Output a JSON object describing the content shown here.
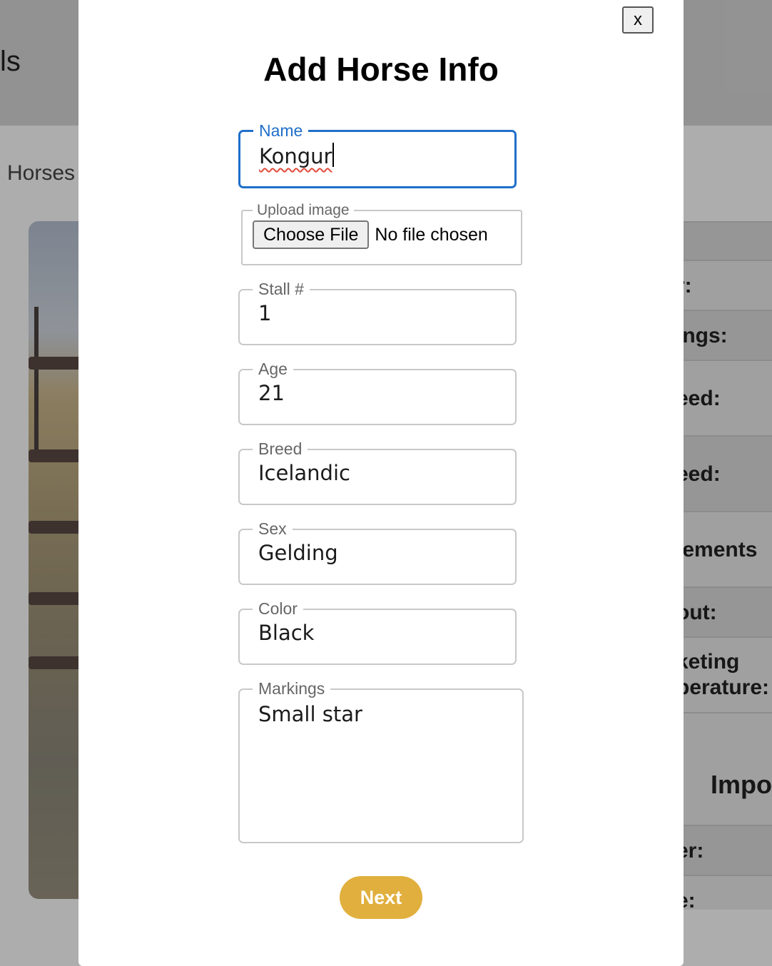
{
  "background": {
    "header_title_fragment": "ls",
    "breadcrumb": "Horses",
    "table_rows": [
      "r:",
      "ings:",
      "eed:",
      "eed:",
      "lements",
      "out:",
      "keting",
      "perature:",
      "Impo",
      "er:",
      "e:"
    ]
  },
  "modal": {
    "close_label": "x",
    "title": "Add Horse Info",
    "fields": {
      "name": {
        "label": "Name",
        "value": "Kongur"
      },
      "upload": {
        "label": "Upload image",
        "button_label": "Choose File",
        "status": "No file chosen"
      },
      "stall": {
        "label": "Stall #",
        "value": "1"
      },
      "age": {
        "label": "Age",
        "value": "21"
      },
      "breed": {
        "label": "Breed",
        "value": "Icelandic"
      },
      "sex": {
        "label": "Sex",
        "value": "Gelding"
      },
      "color": {
        "label": "Color",
        "value": "Black"
      },
      "markings": {
        "label": "Markings",
        "value": "Small star"
      }
    },
    "next_label": "Next"
  },
  "colors": {
    "focus_border": "#1f6fc9",
    "next_button": "#e1af3d"
  }
}
